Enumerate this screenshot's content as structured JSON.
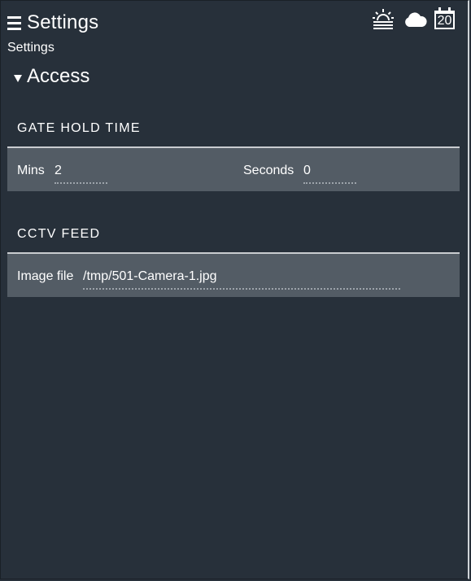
{
  "header": {
    "title": "Settings",
    "breadcrumb": "Settings",
    "icons": [
      "menu-icon",
      "sunrise-icon",
      "cloud-icon",
      "calendar-icon"
    ],
    "calendar_day": "20"
  },
  "section": {
    "label": "Access",
    "expanded": true
  },
  "gate_hold_time": {
    "title": "GATE HOLD TIME",
    "mins_label": "Mins",
    "mins_value": "2",
    "seconds_label": "Seconds",
    "seconds_value": "0"
  },
  "cctv_feed": {
    "title": "CCTV FEED",
    "image_file_label": "Image file",
    "image_file_value": "/tmp/501-Camera-1.jpg"
  },
  "colors": {
    "background": "#27303a",
    "panel": "#535c65",
    "panel_border": "#c9ccd0",
    "text": "#ffffff"
  }
}
